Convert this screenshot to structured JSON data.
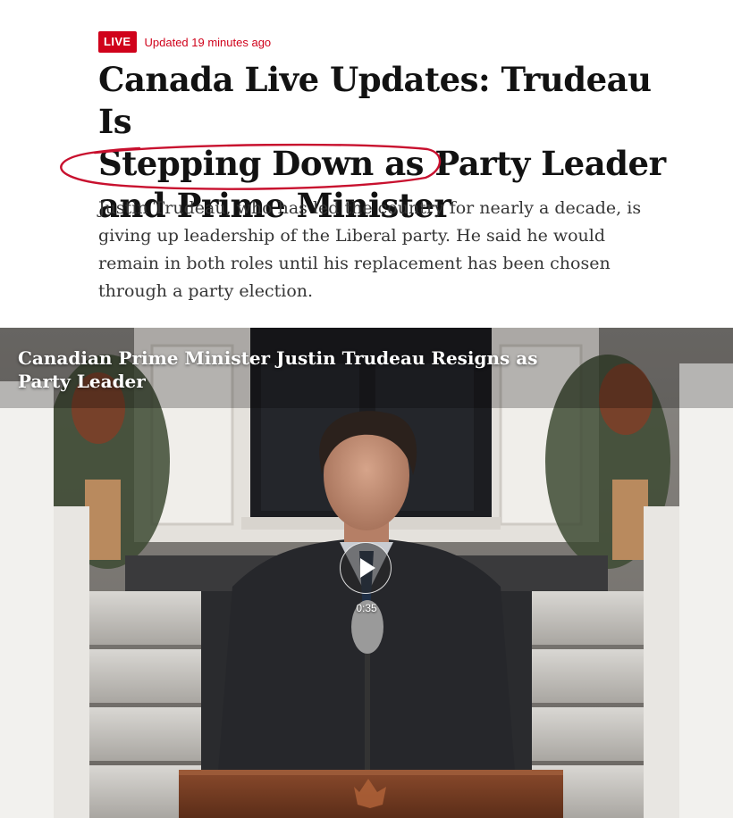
{
  "article": {
    "live_label": "LIVE",
    "updated": "Updated 19 minutes ago",
    "headline_line1": "Canada Live Updates: Trudeau Is",
    "headline_line2": "Stepping Down as Party Leader",
    "headline_line3": "and Prime Minister",
    "summary": "Justin Trudeau, who has led the country for nearly a decade, is giving up leadership of the Liberal party. He said he would remain in both roles until his replacement has been chosen through a party election."
  },
  "video": {
    "caption": "Canadian Prime Minister Justin Trudeau Resigns as Party Leader",
    "duration": "0:35",
    "play_icon": "play-icon"
  },
  "colors": {
    "live_red": "#d0021b",
    "annotation_red": "#c8102e",
    "headline": "#121212",
    "summary": "#363636"
  }
}
